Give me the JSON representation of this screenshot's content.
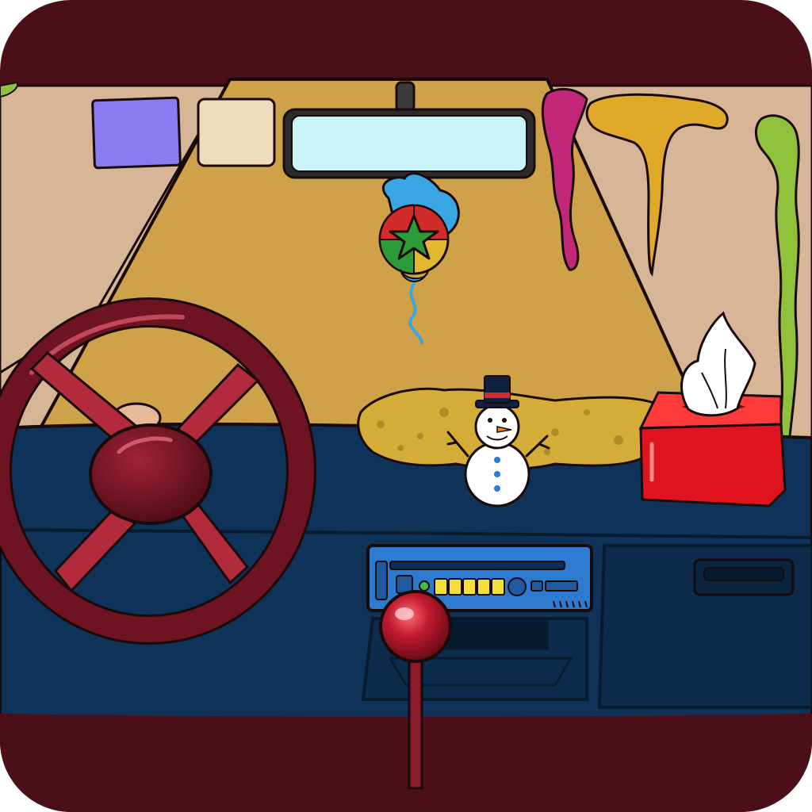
{
  "app": {
    "icon_shape": "rounded-square",
    "scene": "car-interior"
  },
  "colors": {
    "frame": "#4a0f18",
    "headliner": "#d7b597",
    "windshield": "#cfa24a",
    "dashboard": "#0f3358",
    "dash_lower": "#0d2c4d",
    "steering_wheel": "#6e1322",
    "steering_spokes": "#b12b3c",
    "tissue_box": "#e0141e",
    "mirror_glass": "#c9f4f7",
    "sticker_purple": "#8a7bf0",
    "sticker_cream": "#efdcbc",
    "ornament_green": "#2c9b3a",
    "ornament_blue": "#3aa6e3",
    "slime_green": "#8fc23a",
    "slime_yellow": "#e0a92a",
    "slime_magenta": "#c2277a",
    "radio_face": "#2d7bd0",
    "radio_buttons": "#f3e03a",
    "gear_knob": "#b5162a"
  },
  "objects": [
    {
      "id": "steering-wheel",
      "icon": "steering-wheel-icon"
    },
    {
      "id": "rearview-mirror",
      "icon": "mirror-icon"
    },
    {
      "id": "hanging-ornament",
      "icon": "star-ornament-icon"
    },
    {
      "id": "snowman",
      "icon": "snowman-icon"
    },
    {
      "id": "tissue-box",
      "icon": "tissue-box-icon"
    },
    {
      "id": "radio",
      "icon": "radio-icon"
    },
    {
      "id": "gear-shift",
      "icon": "gear-shift-icon"
    },
    {
      "id": "glovebox-handle",
      "icon": "handle-icon"
    },
    {
      "id": "purple-sticker",
      "icon": "note-icon"
    },
    {
      "id": "cream-sticker",
      "icon": "note-icon"
    },
    {
      "id": "green-slime",
      "icon": "slime-icon"
    },
    {
      "id": "yellow-slime",
      "icon": "slime-icon"
    },
    {
      "id": "magenta-slime",
      "icon": "slime-icon"
    },
    {
      "id": "dashboard-sludge",
      "icon": "sludge-icon"
    }
  ]
}
